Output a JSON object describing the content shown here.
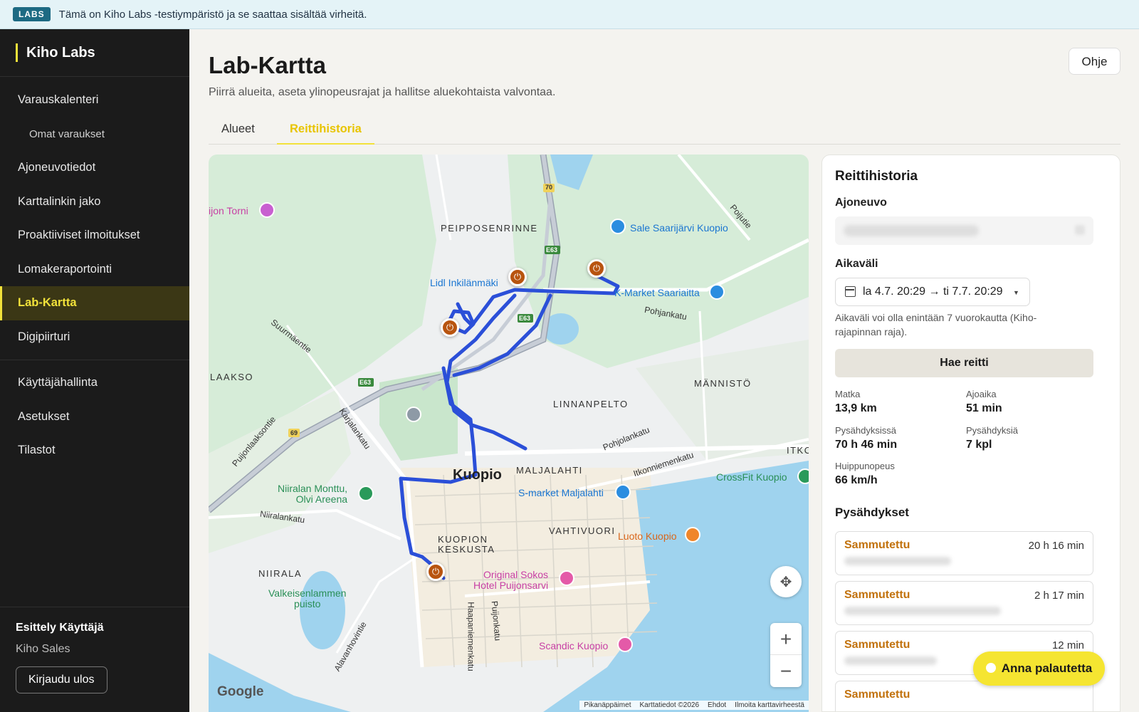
{
  "banner": {
    "tag": "LABS",
    "message": "Tämä on Kiho Labs -testiympäristö ja se saattaa sisältää virheitä."
  },
  "sidebar": {
    "brand": "Kiho Labs",
    "items_primary": [
      {
        "label": "Varauskalenteri"
      },
      {
        "label": "Omat varaukset",
        "sub": true
      },
      {
        "label": "Ajoneuvotiedot"
      },
      {
        "label": "Karttalinkin jako"
      },
      {
        "label": "Proaktiiviset ilmoitukset"
      },
      {
        "label": "Lomakeraportointi"
      },
      {
        "label": "Lab-Kartta",
        "active": true
      },
      {
        "label": "Digipiirturi"
      }
    ],
    "items_secondary": [
      {
        "label": "Käyttäjähallinta"
      },
      {
        "label": "Asetukset"
      },
      {
        "label": "Tilastot"
      }
    ],
    "user": {
      "name": "Esittely Käyttäjä",
      "org": "Kiho Sales",
      "logout_label": "Kirjaudu ulos"
    }
  },
  "header": {
    "title": "Lab-Kartta",
    "subtitle": "Piirrä alueita, aseta ylinopeusrajat ja hallitse aluekohtaista valvontaa.",
    "help_label": "Ohje"
  },
  "tabs": [
    {
      "label": "Alueet"
    },
    {
      "label": "Reittihistoria",
      "active": true
    }
  ],
  "map": {
    "labels": {
      "peipposenrinne": "PEIPPOSENRINNE",
      "laakso": "LAAKSO",
      "mannisto": "MÄNNISTÖ",
      "linnanpelto": "LINNANPELTO",
      "maljalahti": "MALJALAHTI",
      "vahtivuori": "VAHTIVUORI",
      "keskusta": "KUOPION\nKESKUSTA",
      "niirala": "NIIRALA",
      "itko": "ITKO",
      "city": "Kuopio",
      "torni": "ijon Torni",
      "sale": "Sale Saarijärvi Kuopio",
      "lidl": "Lidl Inkilänmäki",
      "kmarket": "K-Market Saariaitta",
      "crossfit": "CrossFit Kuopio",
      "niiralan": "Niiralan Monttu,\nOlvi Areena",
      "smarket": "S-market Maljalahti",
      "luoto": "Luoto Kuopio",
      "sokos": "Original Sokos\nHotel Puijonsarvi",
      "valkeis": "Valkeisenlammen\npuisto",
      "scandic": "Scandic Kuopio",
      "pohjankatu": "Pohjankatu",
      "suurmaentie": "Suurmäentie",
      "pohjolankatu": "Pohjolankatu",
      "itkonniemenkatu": "Itkonniemenkatu",
      "niiralankatu": "Niiralankatu",
      "karjalankatu": "Karjalankatu",
      "puijonlaaksontie": "Puijonlaaksontie",
      "haapaniemenkatu": "Haapaniemenkatu",
      "puijonkatu": "Puijonkatu",
      "alavanhovintie": "Alavanhovintie",
      "pohjolantie": "Poijutie",
      "e63": "E63",
      "r70": "70",
      "r69": "69"
    },
    "google": "Google",
    "attribution": [
      "Pikanäppäimet",
      "Karttatiedot ©2026",
      "Ehdot",
      "Ilmoita karttavirheestä"
    ],
    "zoom_in": "+",
    "zoom_out": "−",
    "route_color": "#2b4fd8",
    "stop_marker_color": "#b8540f"
  },
  "panel": {
    "title": "Reittihistoria",
    "vehicle_label": "Ajoneuvo",
    "range_label": "Aikaväli",
    "range_value": "la 4.7. 20:29 → ti 7.7. 20:29",
    "range_hint": "Aikaväli voi olla enintään 7 vuorokautta (Kiho-rajapinnan raja).",
    "fetch_label": "Hae reitti",
    "stats": [
      {
        "key": "Matka",
        "value": "13,9 km"
      },
      {
        "key": "Ajoaika",
        "value": "51 min"
      },
      {
        "key": "Pysähdyksissä",
        "value": "70 h 46 min"
      },
      {
        "key": "Pysähdyksiä",
        "value": "7 kpl"
      },
      {
        "key": "Huippunopeus",
        "value": "66 km/h"
      }
    ],
    "stops_title": "Pysähdykset",
    "stops": [
      {
        "status": "Sammutettu",
        "duration": "20 h 16 min"
      },
      {
        "status": "Sammutettu",
        "duration": "2 h 17 min"
      },
      {
        "status": "Sammutettu",
        "duration": "12 min"
      },
      {
        "status": "Sammutettu",
        "duration": ""
      }
    ]
  },
  "feedback_label": "Anna palautetta"
}
